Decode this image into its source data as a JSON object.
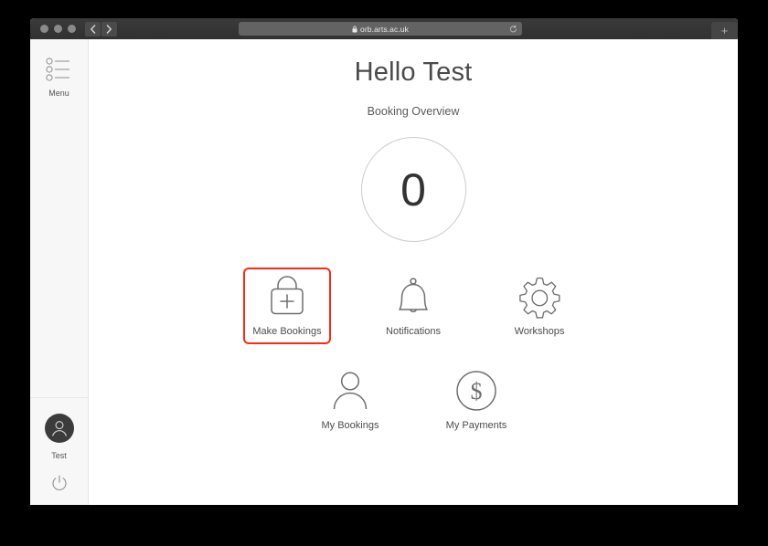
{
  "browser": {
    "window_controls": [
      "close",
      "minimize",
      "zoom"
    ],
    "back_label": "‹",
    "forward_label": "›",
    "url": "orb.arts.ac.uk",
    "lock_icon": "lock-icon",
    "reload_icon": "reload-icon",
    "new_tab_label": "+"
  },
  "sidebar": {
    "menu": {
      "icon": "list-menu-icon",
      "label": "Menu"
    },
    "user": {
      "avatar_icon": "person-avatar-icon",
      "name": "Test",
      "power_icon": "power-icon"
    }
  },
  "main": {
    "title": "Hello Test",
    "subtitle": "Booking Overview",
    "counter": {
      "value": "0"
    },
    "tiles": [
      {
        "label": "Make Bookings",
        "icon": "shopping-bag-plus-icon",
        "highlighted": true
      },
      {
        "label": "Notifications",
        "icon": "bell-icon",
        "highlighted": false
      },
      {
        "label": "Workshops",
        "icon": "gear-icon",
        "highlighted": false
      },
      {
        "label": "My Bookings",
        "icon": "person-icon",
        "highlighted": false
      },
      {
        "label": "My Payments",
        "icon": "dollar-circle-icon",
        "highlighted": false
      }
    ]
  },
  "colors": {
    "highlight": "#fc2a14",
    "titlebar": "#353535",
    "sidebar": "#f7f7f7",
    "text": "#4c4c4c"
  }
}
